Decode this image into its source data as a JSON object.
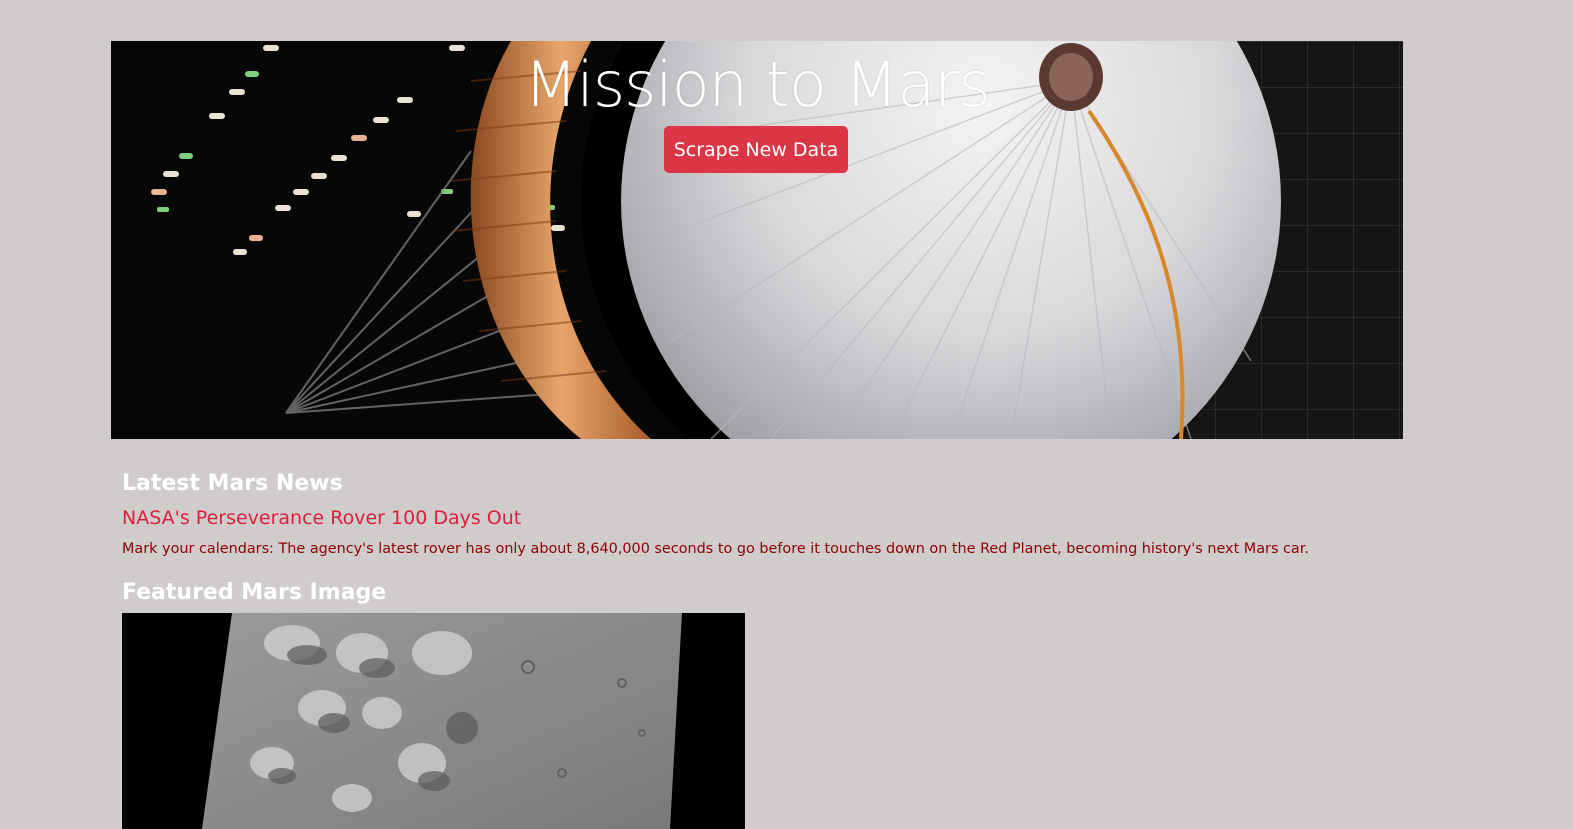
{
  "hero": {
    "title": "Mission to Mars",
    "scrape_button_label": "Scrape New Data"
  },
  "news": {
    "heading": "Latest Mars News",
    "title": "NASA's Perseverance Rover 100 Days Out",
    "teaser": "Mark your calendars: The agency's latest rover has only about 8,640,000 seconds to go before it touches down on the Red Planet, becoming history's next Mars car."
  },
  "featured": {
    "heading": "Featured Mars Image"
  },
  "colors": {
    "page_background": "#d1cccc",
    "button_red": "#dc3545",
    "news_title": "#dc1e3c",
    "news_teaser": "#8b0000",
    "heading_text": "#ffffff"
  }
}
